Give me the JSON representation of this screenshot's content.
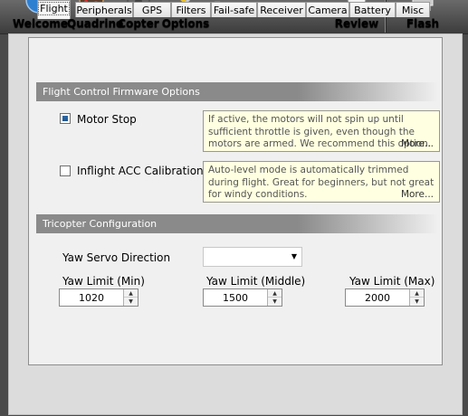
{
  "toolbar": {
    "welcome": "Welcome",
    "quadrino": "Quadrino",
    "copter": "Copter",
    "options": "Options",
    "review": "Review",
    "flash": "Flash"
  },
  "tabs": [
    "Flight",
    "Peripherals",
    "GPS",
    "Filters",
    "Fail-safe",
    "Receiver",
    "Camera",
    "Battery",
    "Misc"
  ],
  "active_tab": "Flight",
  "fc_options": {
    "header": "Flight Control Firmware Options",
    "motor_stop": {
      "label": "Motor Stop",
      "checked": true,
      "note": "If active, the motors will not spin up until sufficient throttle is given, even though the motors are armed. We recommend this option.",
      "more": "More..."
    },
    "inflight_acc": {
      "label": "Inflight ACC Calibration",
      "checked": false,
      "note": "Auto-level mode is automatically trimmed during flight. Great for beginners, but not great for windy conditions.",
      "more": "More..."
    }
  },
  "tricopter": {
    "header": "Tricopter Configuration",
    "yaw_servo_direction": {
      "label": "Yaw Servo Direction",
      "value": ""
    },
    "yaw_limit_min": {
      "label": "Yaw Limit (Min)",
      "value": "1020"
    },
    "yaw_limit_middle": {
      "label": "Yaw Limit (Middle)",
      "value": "1500"
    },
    "yaw_limit_max": {
      "label": "Yaw Limit (Max)",
      "value": "2000"
    }
  },
  "icons": {
    "welcome": "globe-icon",
    "quadrino": "board-icon",
    "copter": "copter-icon",
    "options": "tools-icon",
    "review": "checklist-icon",
    "flash": "flash-chip-icon"
  }
}
